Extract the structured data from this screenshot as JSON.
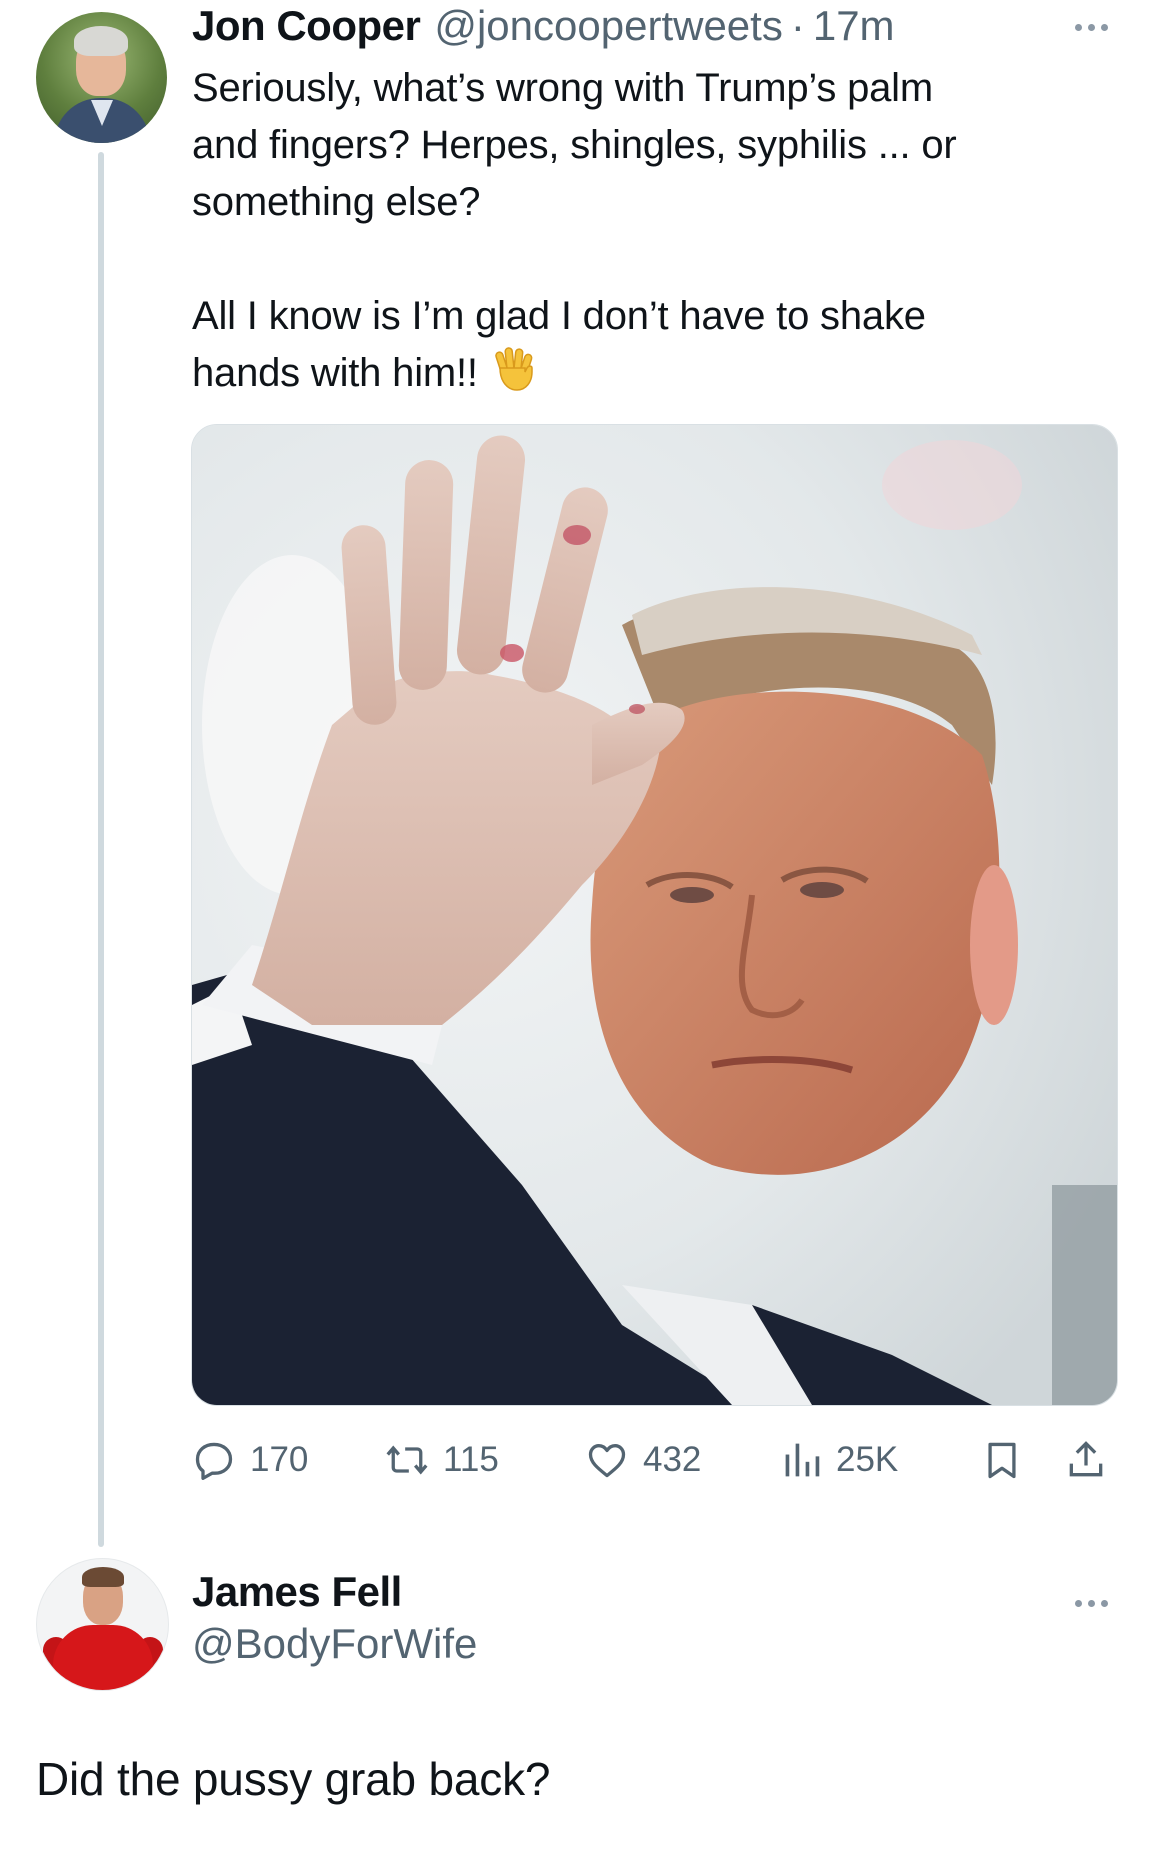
{
  "tweet": {
    "author_name": "Jon Cooper",
    "handle": "@joncoopertweets",
    "separator": "·",
    "time": "17m",
    "text_lines": [
      "Seriously, what’s wrong with Trump’s palm",
      "and fingers? Herpes, shingles, syphilis ... or",
      "something else?"
    ],
    "text_lines_2": [
      "All I know is I’m glad I don’t have to shake",
      "hands with him!!"
    ],
    "emoji": "raised-hand-with-fingers-splayed",
    "media_icon": "photo",
    "stats": {
      "replies": "170",
      "reposts": "115",
      "likes": "432",
      "views": "25K"
    },
    "icons": {
      "reply": "reply-icon",
      "retweet": "retweet-icon",
      "like": "heart-icon",
      "views": "views-icon",
      "bookmark": "bookmark-icon",
      "share": "share-icon",
      "more": "more-icon"
    }
  },
  "reply": {
    "author_name": "James Fell",
    "handle": "@BodyForWife",
    "text": "Did the pussy grab back?"
  },
  "colors": {
    "text_primary": "#0f1419",
    "text_secondary": "#536471",
    "thread_line": "#cfd9de",
    "background": "#ffffff"
  }
}
